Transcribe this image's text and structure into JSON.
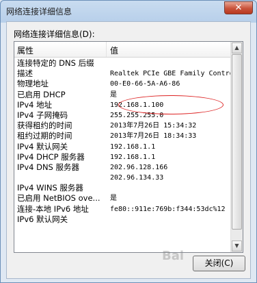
{
  "window": {
    "title": "网络连接详细信息",
    "close_glyph": "✕"
  },
  "details_label": "网络连接详细信息(D):",
  "columns": {
    "property": "属性",
    "value": "值"
  },
  "rows": [
    {
      "prop": "连接特定的 DNS 后缀",
      "val": ""
    },
    {
      "prop": "描述",
      "val": "Realtek PCIe GBE Family Contro"
    },
    {
      "prop": "物理地址",
      "val": "00-E0-66-5A-A6-86"
    },
    {
      "prop": "已启用 DHCP",
      "val": "是"
    },
    {
      "prop": "IPv4 地址",
      "val": "192.168.1.100"
    },
    {
      "prop": "IPv4 子网掩码",
      "val": "255.255.255.0"
    },
    {
      "prop": "获得租约的时间",
      "val": "2013年7月26日 15:34:32"
    },
    {
      "prop": "租约过期的时间",
      "val": "2013年7月26日 18:34:33"
    },
    {
      "prop": "IPv4 默认网关",
      "val": "192.168.1.1"
    },
    {
      "prop": "IPv4 DHCP 服务器",
      "val": "192.168.1.1"
    },
    {
      "prop": "IPv4 DNS 服务器",
      "val": "202.96.128.166"
    },
    {
      "prop": "",
      "val": "202.96.134.33"
    },
    {
      "prop": "IPv4 WINS 服务器",
      "val": ""
    },
    {
      "prop": "已启用 NetBIOS ove...",
      "val": "是"
    },
    {
      "prop": "连接-本地 IPv6 地址",
      "val": "fe80::911e:769b:f344:53dc%12"
    },
    {
      "prop": "IPv6 默认网关",
      "val": ""
    }
  ],
  "buttons": {
    "close_label": "关闭(C)"
  },
  "watermark": "Bai"
}
